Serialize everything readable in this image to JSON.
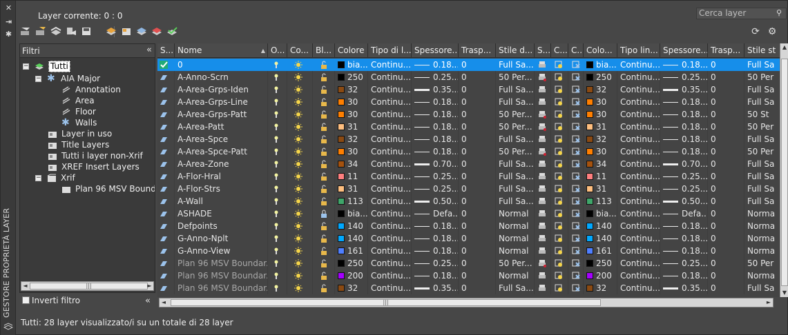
{
  "palette": {
    "accent": "#168eea",
    "panel": "#474747"
  },
  "panel_title": "GESTORE PROPRIETÀ LAYER",
  "current_layer": "Layer corrente: 0 : 0",
  "search": {
    "placeholder": "Cerca layer"
  },
  "filters": {
    "title": "Filtri",
    "tree": [
      {
        "label": "Tutti",
        "icon": "layer-stack-icon"
      },
      {
        "label": "AIA Major",
        "icon": "filter-star-icon"
      },
      {
        "label": "Annotation",
        "icon": "filter-icon"
      },
      {
        "label": "Area",
        "icon": "filter-icon"
      },
      {
        "label": "Floor",
        "icon": "filter-icon"
      },
      {
        "label": "Walls",
        "icon": "filter-star-icon"
      },
      {
        "label": "Layer in uso",
        "icon": "group-filter-icon"
      },
      {
        "label": "Title Layers",
        "icon": "group-filter-icon"
      },
      {
        "label": "Tutti i layer non-Xrif",
        "icon": "group-filter-icon"
      },
      {
        "label": "XREF Insert Layers",
        "icon": "group-filter-icon"
      },
      {
        "label": "Xrif",
        "icon": "xref-icon"
      },
      {
        "label": "Plan 96 MSV Boundary",
        "icon": "xref-file-icon"
      }
    ],
    "invert_label": "Inverti filtro"
  },
  "columns": [
    "S...",
    "Nome",
    "O...",
    "Co...",
    "Bl...",
    "Colore",
    "Tipo di l...",
    "Spessore...",
    "Trasp...",
    "Stile d...",
    "S...",
    "C...",
    "C...",
    "Colo...",
    "Tipo lin...",
    "Spessore...",
    "Trasp...",
    "Stile st"
  ],
  "rows": [
    {
      "name": "0",
      "color_hex": "#000000",
      "color": "bia...",
      "linetype": "Continu...",
      "lw": "0.18...",
      "thick": false,
      "tr": "0",
      "style": "Full Sa...",
      "color2": "bia...",
      "lt2": "Continu...",
      "lw2": "0.18...",
      "tr2": "0",
      "style2": "Full Sa",
      "xref": false
    },
    {
      "name": "A-Anno-Scrn",
      "color_hex": "#000000",
      "color": "250",
      "linetype": "Continu...",
      "lw": "0.25...",
      "thick": false,
      "tr": "0",
      "style": "50 Per...",
      "color2": "250",
      "lt2": "Continu...",
      "lw2": "0.25...",
      "tr2": "0",
      "style2": "50 Per",
      "xref": false
    },
    {
      "name": "A-Area-Grps-Iden",
      "color_hex": "#8b4a12",
      "color": "32",
      "linetype": "Continu...",
      "lw": "0.35...",
      "thick": true,
      "tr": "0",
      "style": "Full Sa...",
      "color2": "32",
      "lt2": "Continu...",
      "lw2": "0.35...",
      "tr2": "0",
      "style2": "Full Sa",
      "xref": false
    },
    {
      "name": "A-Area-Grps-Line",
      "color_hex": "#ff7f00",
      "color": "30",
      "linetype": "Continu...",
      "lw": "0.18...",
      "thick": false,
      "tr": "0",
      "style": "Full Sa...",
      "color2": "30",
      "lt2": "Continu...",
      "lw2": "0.18...",
      "tr2": "0",
      "style2": "Full Sa",
      "xref": false
    },
    {
      "name": "A-Area-Grps-Patt",
      "color_hex": "#ff7f00",
      "color": "30",
      "linetype": "Continu...",
      "lw": "0.18...",
      "thick": false,
      "tr": "0",
      "style": "50 Per...",
      "color2": "30",
      "lt2": "Continu...",
      "lw2": "0.18...",
      "tr2": "0",
      "style2": "50 St",
      "xref": false
    },
    {
      "name": "A-Area-Patt",
      "color_hex": "#ffbf7f",
      "color": "31",
      "linetype": "Continu...",
      "lw": "0.18...",
      "thick": false,
      "tr": "0",
      "style": "50 Per...",
      "color2": "31",
      "lt2": "Continu...",
      "lw2": "0.18...",
      "tr2": "0",
      "style2": "50 Per",
      "xref": false
    },
    {
      "name": "A-Area-Spce",
      "color_hex": "#8b4a12",
      "color": "32",
      "linetype": "Continu...",
      "lw": "0.18...",
      "thick": false,
      "tr": "0",
      "style": "Full Sa...",
      "color2": "32",
      "lt2": "Continu...",
      "lw2": "0.18...",
      "tr2": "0",
      "style2": "Full Sa",
      "xref": false
    },
    {
      "name": "A-Area-Spce-Patt",
      "color_hex": "#ff7f00",
      "color": "30",
      "linetype": "Continu...",
      "lw": "0.18...",
      "thick": false,
      "tr": "0",
      "style": "50 Per...",
      "color2": "30",
      "lt2": "Continu...",
      "lw2": "0.18...",
      "tr2": "0",
      "style2": "50 Per",
      "xref": false
    },
    {
      "name": "A-Area-Zone",
      "color_hex": "#a5520e",
      "color": "34",
      "linetype": "Continu...",
      "lw": "0.70...",
      "thick": true,
      "tr": "0",
      "style": "Full Sa...",
      "color2": "34",
      "lt2": "Continu...",
      "lw2": "0.70...",
      "tr2": "0",
      "style2": "Full Sa",
      "xref": false
    },
    {
      "name": "A-Flor-Hral",
      "color_hex": "#ff7f7f",
      "color": "11",
      "linetype": "Continu...",
      "lw": "0.25...",
      "thick": false,
      "tr": "0",
      "style": "Full Sa...",
      "color2": "11",
      "lt2": "Continu...",
      "lw2": "0.25...",
      "tr2": "0",
      "style2": "Full Sa",
      "xref": false
    },
    {
      "name": "A-Flor-Strs",
      "color_hex": "#ffbf7f",
      "color": "31",
      "linetype": "Continu...",
      "lw": "0.25...",
      "thick": false,
      "tr": "0",
      "style": "Full Sa...",
      "color2": "31",
      "lt2": "Continu...",
      "lw2": "0.25...",
      "tr2": "0",
      "style2": "Full Sa",
      "xref": false
    },
    {
      "name": "A-Wall",
      "color_hex": "#3fa66a",
      "color": "113",
      "linetype": "Continu...",
      "lw": "0.50...",
      "thick": true,
      "tr": "0",
      "style": "Full Sa...",
      "color2": "113",
      "lt2": "Continu...",
      "lw2": "0.50...",
      "tr2": "0",
      "style2": "Full Sa",
      "xref": false
    },
    {
      "name": "ASHADE",
      "color_hex": "#000000",
      "color": "bia...",
      "linetype": "Continu...",
      "lw": "Defa...",
      "thick": false,
      "tr": "0",
      "style": "Normal",
      "color2": "bia...",
      "lt2": "Continu...",
      "lw2": "Defa...",
      "tr2": "0",
      "style2": "Norma",
      "xref": false
    },
    {
      "name": "Defpoints",
      "color_hex": "#00a8ff",
      "color": "140",
      "linetype": "Continu...",
      "lw": "0.18...",
      "thick": false,
      "tr": "0",
      "style": "Normal",
      "color2": "140",
      "lt2": "Continu...",
      "lw2": "0.18...",
      "tr2": "0",
      "style2": "Norma",
      "xref": false
    },
    {
      "name": "G-Anno-Nplt",
      "color_hex": "#00a8ff",
      "color": "140",
      "linetype": "Continu...",
      "lw": "0.18...",
      "thick": false,
      "tr": "0",
      "style": "Normal",
      "color2": "140",
      "lt2": "Continu...",
      "lw2": "0.18...",
      "tr2": "0",
      "style2": "Norma",
      "xref": false
    },
    {
      "name": "G-Anno-View",
      "color_hex": "#4f7fff",
      "color": "161",
      "linetype": "Continu...",
      "lw": "0.18...",
      "thick": false,
      "tr": "0",
      "style": "Normal",
      "color2": "161",
      "lt2": "Continu...",
      "lw2": "0.18...",
      "tr2": "0",
      "style2": "Norma",
      "xref": false
    },
    {
      "name": "Plan 96 MSV Boundar...",
      "color_hex": "#000000",
      "color": "250",
      "linetype": "Continu...",
      "lw": "0.25...",
      "thick": false,
      "tr": "0",
      "style": "50 Per...",
      "color2": "250",
      "lt2": "Continu...",
      "lw2": "0.25...",
      "tr2": "0",
      "style2": "50 Per",
      "xref": true
    },
    {
      "name": "Plan 96 MSV Boundar...",
      "color_hex": "#a500ff",
      "color": "200",
      "linetype": "Continu...",
      "lw": "0.18...",
      "thick": false,
      "tr": "0",
      "style": "Normal",
      "color2": "200",
      "lt2": "Continu...",
      "lw2": "0.18...",
      "tr2": "0",
      "style2": "Norma",
      "xref": true
    },
    {
      "name": "Plan 96 MSV Boundar...",
      "color_hex": "#8b4a12",
      "color": "32",
      "linetype": "Continu...",
      "lw": "0.35...",
      "thick": true,
      "tr": "0",
      "style": "Full Sa...",
      "color2": "32",
      "lt2": "Continu...",
      "lw2": "0.35...",
      "tr2": "0",
      "style2": "Full Sa",
      "xref": true
    }
  ],
  "status": "Tutti: 28 layer visualizzato/i su un totale di 28 layer"
}
